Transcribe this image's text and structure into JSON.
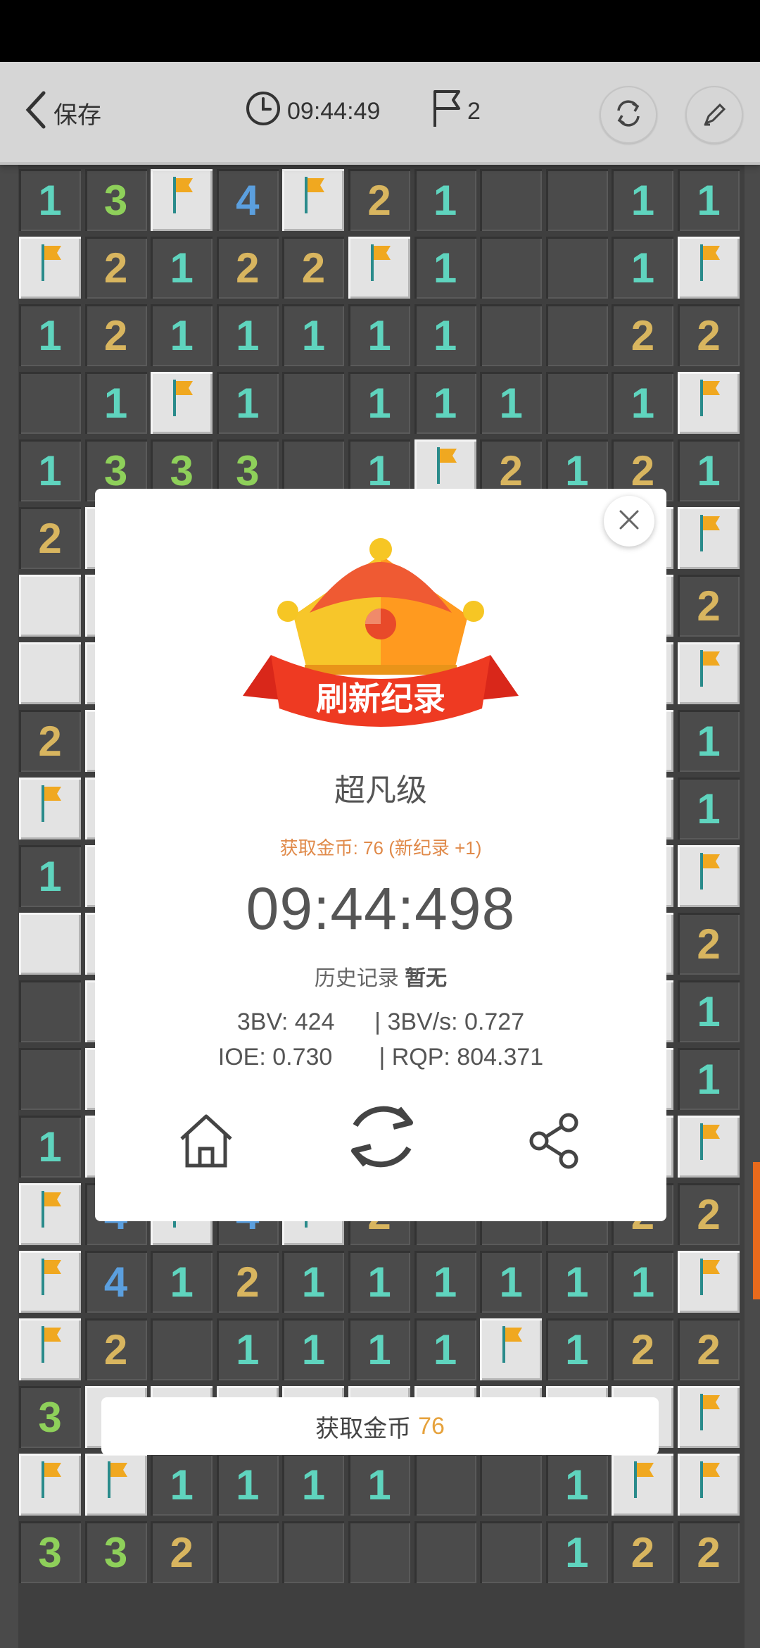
{
  "header": {
    "back_label": "保存",
    "timer": "09:44:49",
    "flag_count": "2",
    "icons": [
      "back-chevron-icon",
      "clock-icon",
      "flag-icon",
      "refresh-icon",
      "pencil-icon"
    ]
  },
  "colors": {
    "one": "#5fd4be",
    "two": "#d8b55f",
    "three": "#8ed05a",
    "four": "#5b9fde",
    "flag": "#f0a820",
    "accent": "#e86a1c"
  },
  "board": {
    "columns": 11,
    "legend": "F = flag, R = unopened, . = revealed empty",
    "rows": [
      "13F4F21..11",
      "F2122F1..1F",
      "1211111..22",
      ".1F1.111.1F",
      "1333.1F2121",
      "2RRRRRRRRRF",
      "RRRRRRRRRR2",
      "RRRRRRRRRRF",
      "2RRRRRRRRR1",
      "FRRRRRRRRR1",
      "1RRRRRRRRRF",
      "RRRRRRRRRR2",
      ".RRRRRRRRR1",
      ".RRRRRRRRR1",
      "1RRRRRRRRRF",
      "F4F4F2...22",
      "F41211111 1F",
      "F2.1111F122",
      "3RRRRRRRRRF",
      "FF1111..1FF",
      "332.....122"
    ]
  },
  "dialog": {
    "ribbon_text": "刷新纪录",
    "level": "超凡级",
    "coins_text": "获取金币: 76 (新纪录 +1)",
    "time": "09:44:498",
    "history_label": "历史记录",
    "history_value": "暂无",
    "stats_line1": "3BV: 424      | 3BV/s: 0.727",
    "stats_line2": "IOE: 0.730       | RQP: 804.371",
    "icons": [
      "close-icon",
      "crown-icon",
      "home-icon",
      "replay-icon",
      "share-icon"
    ]
  },
  "coinbar": {
    "label": "获取金币",
    "value": "76"
  }
}
